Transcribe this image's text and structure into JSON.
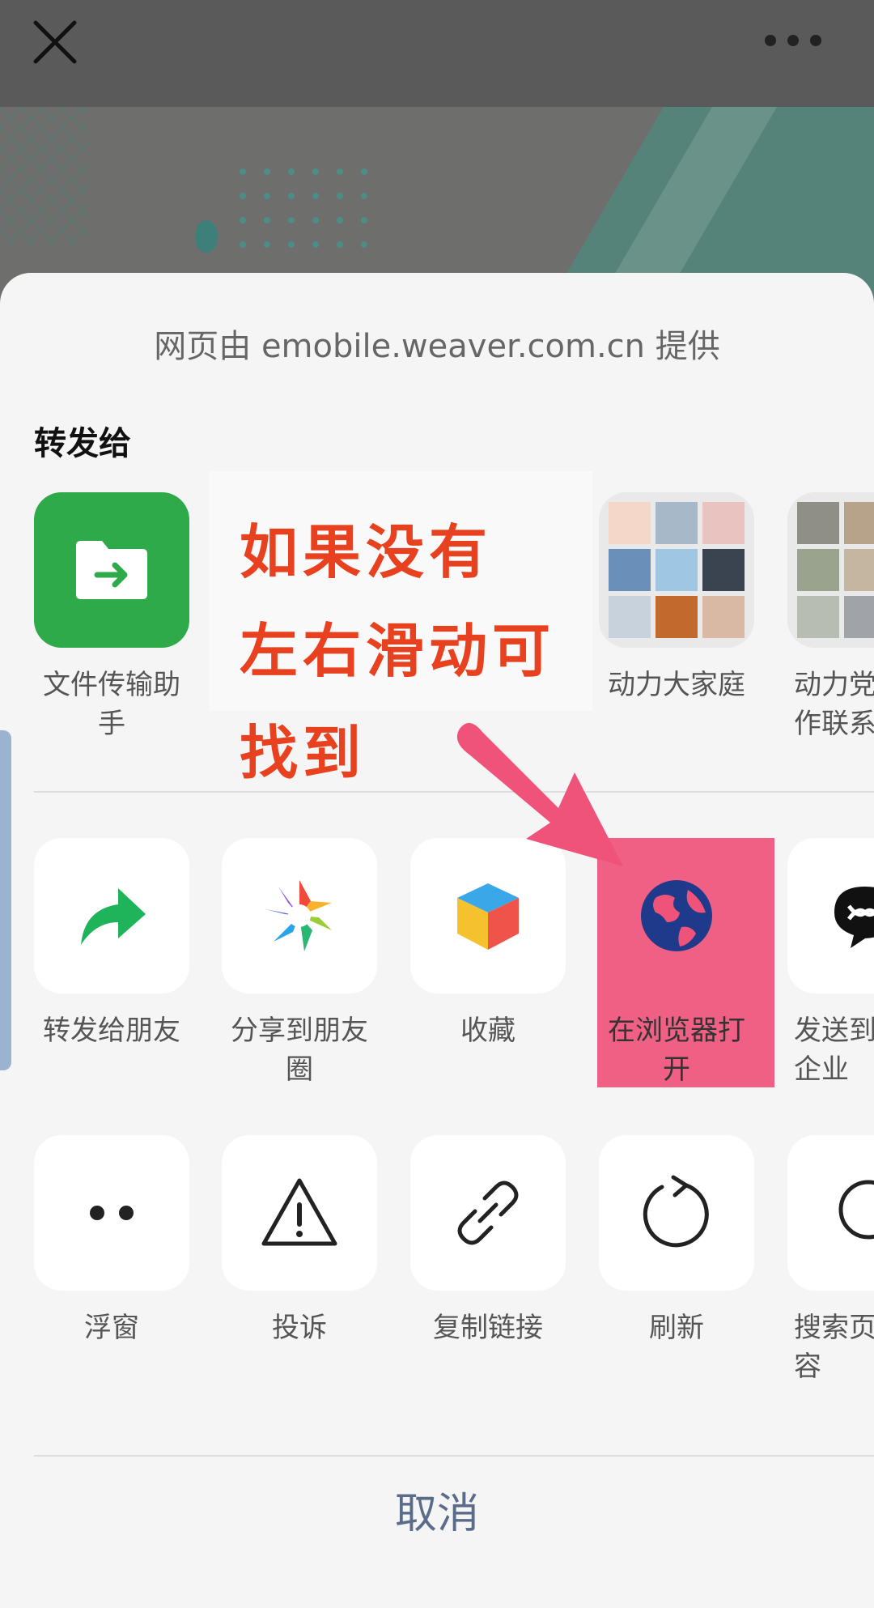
{
  "header": {
    "close_icon": "close-icon",
    "more_icon": "more-dots-icon"
  },
  "sheet": {
    "provider_text": "网页由 emobile.weaver.com.cn 提供",
    "forward_title": "转发给",
    "contacts": [
      {
        "label": "文件传输助\n手",
        "icon": "file-transfer-icon",
        "color": "#2faa4b"
      },
      {
        "label": "动力大家庭",
        "icon": "group-avatar-grid"
      },
      {
        "label": "动力党\n作联系",
        "icon": "group-avatar-grid"
      }
    ],
    "actions_row1": [
      {
        "label": "转发给朋友",
        "icon": "share-arrow-icon"
      },
      {
        "label": "分享到朋友\n圈",
        "icon": "moments-aperture-icon"
      },
      {
        "label": "收藏",
        "icon": "favorite-cube-icon"
      },
      {
        "label": "在浏览器打\n开",
        "icon": "browser-globe-icon"
      },
      {
        "label": "发送到\n企业",
        "icon": "wecom-icon"
      }
    ],
    "actions_row2": [
      {
        "label": "浮窗",
        "icon": "float-window-icon"
      },
      {
        "label": "投诉",
        "icon": "warning-icon"
      },
      {
        "label": "复制链接",
        "icon": "link-icon"
      },
      {
        "label": "刷新",
        "icon": "refresh-icon"
      },
      {
        "label": "搜索页\n容",
        "icon": "search-icon"
      }
    ],
    "cancel_label": "取消"
  },
  "annotation": {
    "lines": [
      "如果没有",
      "左右滑动可",
      "找到"
    ],
    "text_color": "#e8411f",
    "highlight_color": "#ef5379"
  }
}
